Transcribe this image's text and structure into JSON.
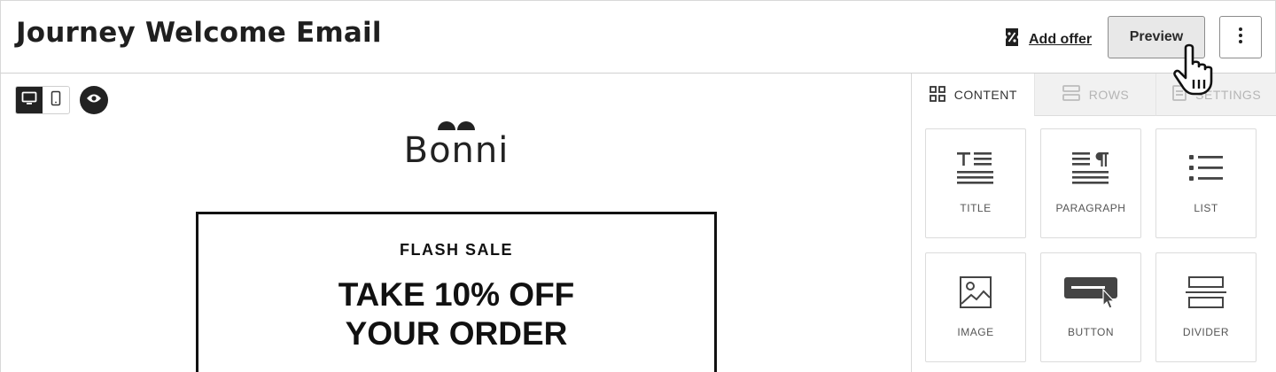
{
  "header": {
    "title": "Journey Welcome Email",
    "add_offer_label": "Add offer",
    "add_offer_icon": "percent-tag-icon",
    "preview_label": "Preview",
    "more_icon": "vertical-ellipsis-icon"
  },
  "canvas": {
    "device_toggle": {
      "desktop_icon": "desktop-icon",
      "mobile_icon": "mobile-icon",
      "active": "desktop"
    },
    "preview_icon": "eye-icon",
    "logo_text": "Bonni",
    "promo": {
      "eyebrow": "FLASH SALE",
      "headline_line1": "TAKE 10% OFF",
      "headline_line2": "YOUR ORDER"
    }
  },
  "panel": {
    "tabs": [
      {
        "label": "CONTENT",
        "icon": "grid-icon",
        "active": true
      },
      {
        "label": "ROWS",
        "icon": "rows-icon",
        "active": false
      },
      {
        "label": "SETTINGS",
        "icon": "settings-doc-icon",
        "active": false
      }
    ],
    "blocks": [
      {
        "label": "TITLE",
        "icon": "title-icon"
      },
      {
        "label": "PARAGRAPH",
        "icon": "paragraph-icon"
      },
      {
        "label": "LIST",
        "icon": "list-icon"
      },
      {
        "label": "IMAGE",
        "icon": "image-icon"
      },
      {
        "label": "BUTTON",
        "icon": "button-icon"
      },
      {
        "label": "DIVIDER",
        "icon": "divider-icon"
      }
    ]
  },
  "colors": {
    "accent_dark": "#222222",
    "border": "#d8d8d8",
    "preview_bg": "#e8e8e8",
    "inactive_tab_bg": "#f1f1f1"
  }
}
